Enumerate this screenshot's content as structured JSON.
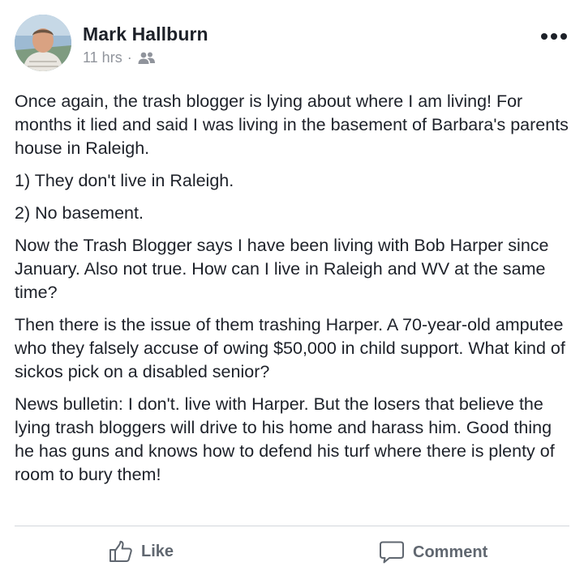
{
  "post": {
    "author": "Mark Hallburn",
    "time": "11 hrs",
    "separator": "·",
    "audience_icon": "friends-icon",
    "more_icon": "more-options-icon",
    "paragraphs": [
      "Once again, the trash blogger is lying about where I am living! For months it lied and said I was living in the basement of Barbara's parents house in Raleigh.",
      "1) They don't live in Raleigh.",
      "2) No basement.",
      "Now the Trash Blogger says I have been living with Bob Harper since January. Also not true. How can I live in Raleigh and WV at the same time?",
      "Then there is the issue of them trashing Harper. A 70-year-old amputee who they falsely accuse of owing $50,000 in child support. What kind of sickos pick on a disabled senior?",
      "News bulletin: I don't. live with Harper. But the losers that believe the lying trash bloggers will drive to his home and harass him. Good thing he has guns and knows how to defend his turf where there is plenty of room to bury them!"
    ]
  },
  "actions": {
    "like_label": "Like",
    "comment_label": "Comment"
  },
  "colors": {
    "text": "#1d2129",
    "meta": "#90949c",
    "action": "#606770",
    "divider": "#d3d6db"
  }
}
